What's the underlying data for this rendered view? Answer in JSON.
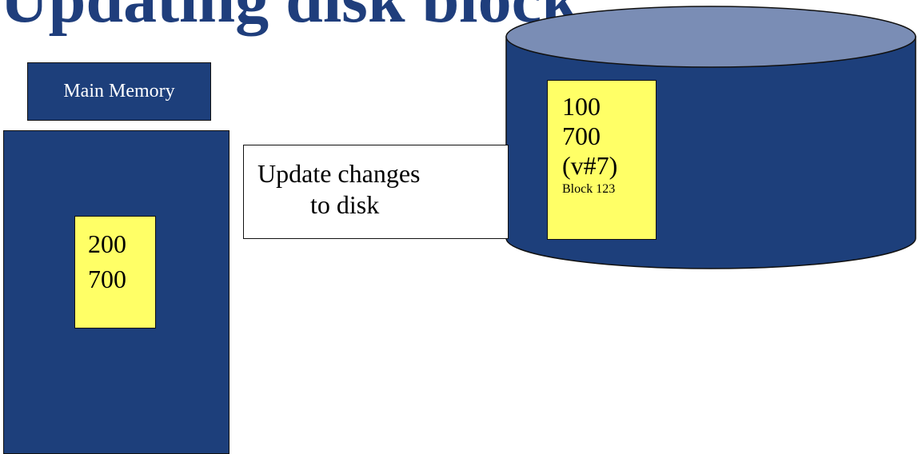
{
  "title": "Updating disk block",
  "main_memory": {
    "label": "Main Memory",
    "block": {
      "line1": "200",
      "line2": "700"
    }
  },
  "update_note": {
    "line1": "Update changes",
    "line2": "to disk"
  },
  "disk": {
    "block": {
      "line1": "100",
      "line2": "700",
      "line3": "(v#7)",
      "name": "Block 123"
    }
  },
  "colors": {
    "title": "#1f3e7c",
    "navy_fill": "#1d3f7b",
    "disk_top": "#7a8db5",
    "block_fill": "#ffff66"
  }
}
